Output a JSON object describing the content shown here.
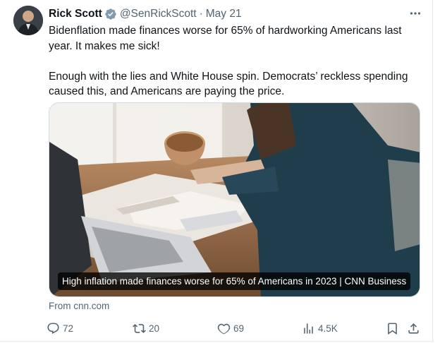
{
  "author": {
    "name": "Rick Scott",
    "handle": "@SenRickScott",
    "separator": "·",
    "date": "May 21"
  },
  "tweet": {
    "paragraph_1": "Bidenflation made finances worse for 65% of hardworking Americans last year. It makes me sick!",
    "paragraph_2": "Enough with the lies and White House spin. Democrats’ reckless spending caused this, and Americans are paying the price."
  },
  "link_card": {
    "caption": "High inflation made finances worse for 65% of Americans in 2023 | CNN Business",
    "source": "From cnn.com"
  },
  "actions": {
    "replies": "72",
    "reposts": "20",
    "likes": "69",
    "views": "4.5K"
  },
  "icons": {
    "verified": "verified-badge-icon",
    "more": "more-dots-icon",
    "reply": "reply-bubble-icon",
    "repost": "repost-arrows-icon",
    "like": "heart-icon",
    "views": "bar-chart-icon",
    "bookmark": "bookmark-icon",
    "share": "share-upload-icon"
  },
  "colors": {
    "text": "#0f1419",
    "muted": "#536471",
    "verified_badge": "#829aab",
    "border": "#cfd9de"
  }
}
